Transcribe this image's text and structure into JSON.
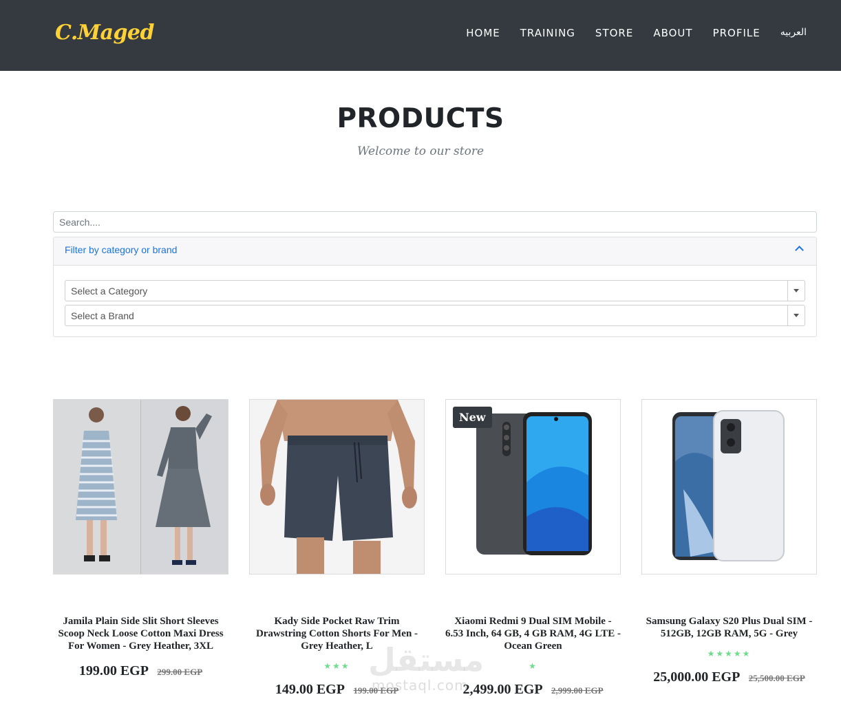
{
  "navbar": {
    "brand": "C.Maged",
    "links": [
      "HOME",
      "TRAINING",
      "STORE",
      "ABOUT",
      "PROFILE",
      "العربيه"
    ]
  },
  "page": {
    "title": "PRODUCTS",
    "subtitle": "Welcome to our store"
  },
  "search": {
    "placeholder": "Search...."
  },
  "filter": {
    "title": "Filter by category or brand",
    "category_placeholder": "Select a Category",
    "brand_placeholder": "Select a Brand"
  },
  "products": [
    {
      "name": "Jamila Plain Side Slit Short Sleeves Scoop Neck Loose Cotton Maxi Dress For Women - Grey Heather, 3XL",
      "price": "199.00 EGP",
      "old_price": "299.00 EGP",
      "stars": 0,
      "badge": ""
    },
    {
      "name": "Kady Side Pocket Raw Trim Drawstring Cotton Shorts For Men - Grey Heather, L",
      "price": "149.00 EGP",
      "old_price": "199.00 EGP",
      "stars": 3,
      "badge": ""
    },
    {
      "name": "Xiaomi Redmi 9 Dual SIM Mobile - 6.53 Inch, 64 GB, 4 GB RAM, 4G LTE - Ocean Green",
      "price": "2,499.00 EGP",
      "old_price": "2,999.00 EGP",
      "stars": 1,
      "badge": "New"
    },
    {
      "name": "Samsung Galaxy S20 Plus Dual SIM - 512GB, 12GB RAM, 5G - Grey",
      "price": "25,000.00 EGP",
      "old_price": "25,500.00 EGP",
      "stars": 5,
      "badge": ""
    }
  ],
  "watermark": {
    "arabic": "مستقل",
    "latin": "mostaql.com"
  },
  "colors": {
    "navbar_bg": "#343a40",
    "brand": "#fed136",
    "link_blue": "#1a73e8",
    "star_green": "#6fdc8c"
  }
}
